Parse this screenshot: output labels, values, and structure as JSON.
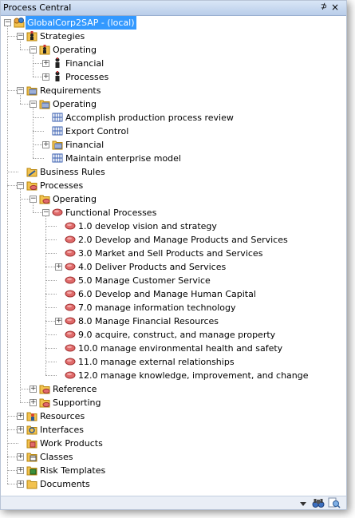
{
  "window": {
    "title": "Process Central",
    "pin_glyph": "⊅",
    "close_glyph": "×"
  },
  "tree": [
    {
      "label": "GlobalCorp2SAP - (local)",
      "icon": "repository-icon",
      "depth": 0,
      "expander": "minus",
      "selected": true
    },
    {
      "label": "Strategies",
      "icon": "strategy-icon",
      "depth": 1,
      "expander": "minus"
    },
    {
      "label": "Operating",
      "icon": "strategy-icon",
      "depth": 2,
      "expander": "minus"
    },
    {
      "label": "Financial",
      "icon": "strategy-figure-icon",
      "depth": 3,
      "expander": "plus"
    },
    {
      "label": "Processes",
      "icon": "strategy-figure-icon",
      "depth": 3,
      "expander": "plus"
    },
    {
      "label": "Requirements",
      "icon": "requirements-folder-icon",
      "depth": 1,
      "expander": "minus"
    },
    {
      "label": "Operating",
      "icon": "requirements-folder-icon",
      "depth": 2,
      "expander": "minus"
    },
    {
      "label": "Accomplish production process review",
      "icon": "requirement-icon",
      "depth": 3,
      "expander": "none"
    },
    {
      "label": "Export Control",
      "icon": "requirement-icon",
      "depth": 3,
      "expander": "none"
    },
    {
      "label": "Financial",
      "icon": "requirements-folder-icon",
      "depth": 3,
      "expander": "plus"
    },
    {
      "label": "Maintain enterprise model",
      "icon": "requirement-icon",
      "depth": 3,
      "expander": "none"
    },
    {
      "label": "Business Rules",
      "icon": "business-rules-folder-icon",
      "depth": 1,
      "expander": "none"
    },
    {
      "label": "Processes",
      "icon": "process-folder-icon",
      "depth": 1,
      "expander": "minus"
    },
    {
      "label": "Operating",
      "icon": "process-folder-icon",
      "depth": 2,
      "expander": "minus"
    },
    {
      "label": "Functional Processes",
      "icon": "process-icon",
      "depth": 3,
      "expander": "minus"
    },
    {
      "label": "1.0 develop vision and strategy",
      "icon": "process-icon",
      "depth": 4,
      "expander": "none"
    },
    {
      "label": "2.0 Develop and Manage Products and Services",
      "icon": "process-icon",
      "depth": 4,
      "expander": "none"
    },
    {
      "label": "3.0 Market and Sell Products and Services",
      "icon": "process-icon",
      "depth": 4,
      "expander": "none"
    },
    {
      "label": "4.0 Deliver Products and Services",
      "icon": "process-icon",
      "depth": 4,
      "expander": "plus"
    },
    {
      "label": "5.0 Manage Customer Service",
      "icon": "process-icon",
      "depth": 4,
      "expander": "none"
    },
    {
      "label": "6.0 Develop and Manage Human Capital",
      "icon": "process-icon",
      "depth": 4,
      "expander": "none"
    },
    {
      "label": "7.0 manage information technology",
      "icon": "process-icon",
      "depth": 4,
      "expander": "none"
    },
    {
      "label": "8.0 Manage Financial Resources",
      "icon": "process-icon",
      "depth": 4,
      "expander": "plus"
    },
    {
      "label": "9.0 acquire, construct, and manage property",
      "icon": "process-icon",
      "depth": 4,
      "expander": "none"
    },
    {
      "label": "10.0 manage environmental health and safety",
      "icon": "process-icon",
      "depth": 4,
      "expander": "none"
    },
    {
      "label": "11.0 manage external relationships",
      "icon": "process-icon",
      "depth": 4,
      "expander": "none"
    },
    {
      "label": "12.0 manage knowledge, improvement, and change",
      "icon": "process-icon",
      "depth": 4,
      "expander": "none"
    },
    {
      "label": "Reference",
      "icon": "process-folder-icon",
      "depth": 2,
      "expander": "plus"
    },
    {
      "label": "Supporting",
      "icon": "process-folder-icon",
      "depth": 2,
      "expander": "plus"
    },
    {
      "label": "Resources",
      "icon": "resources-folder-icon",
      "depth": 1,
      "expander": "plus"
    },
    {
      "label": "Interfaces",
      "icon": "interfaces-folder-icon",
      "depth": 1,
      "expander": "plus"
    },
    {
      "label": "Work Products",
      "icon": "work-products-folder-icon",
      "depth": 1,
      "expander": "none"
    },
    {
      "label": "Classes",
      "icon": "classes-folder-icon",
      "depth": 1,
      "expander": "plus"
    },
    {
      "label": "Risk Templates",
      "icon": "risk-templates-folder-icon",
      "depth": 1,
      "expander": "plus"
    },
    {
      "label": "Documents",
      "icon": "documents-folder-icon",
      "depth": 1,
      "expander": "plus"
    }
  ],
  "statusbar": {
    "dropdown_icon": "dropdown-arrow-icon",
    "find_icon": "binoculars-icon",
    "find_next_icon": "find-next-icon"
  },
  "colors": {
    "selection": "#3399ff",
    "folder": "#f2c24f",
    "process": "#e06b6b",
    "requirement": "#3a5fb0",
    "title_bar": "#c7d8ef"
  }
}
